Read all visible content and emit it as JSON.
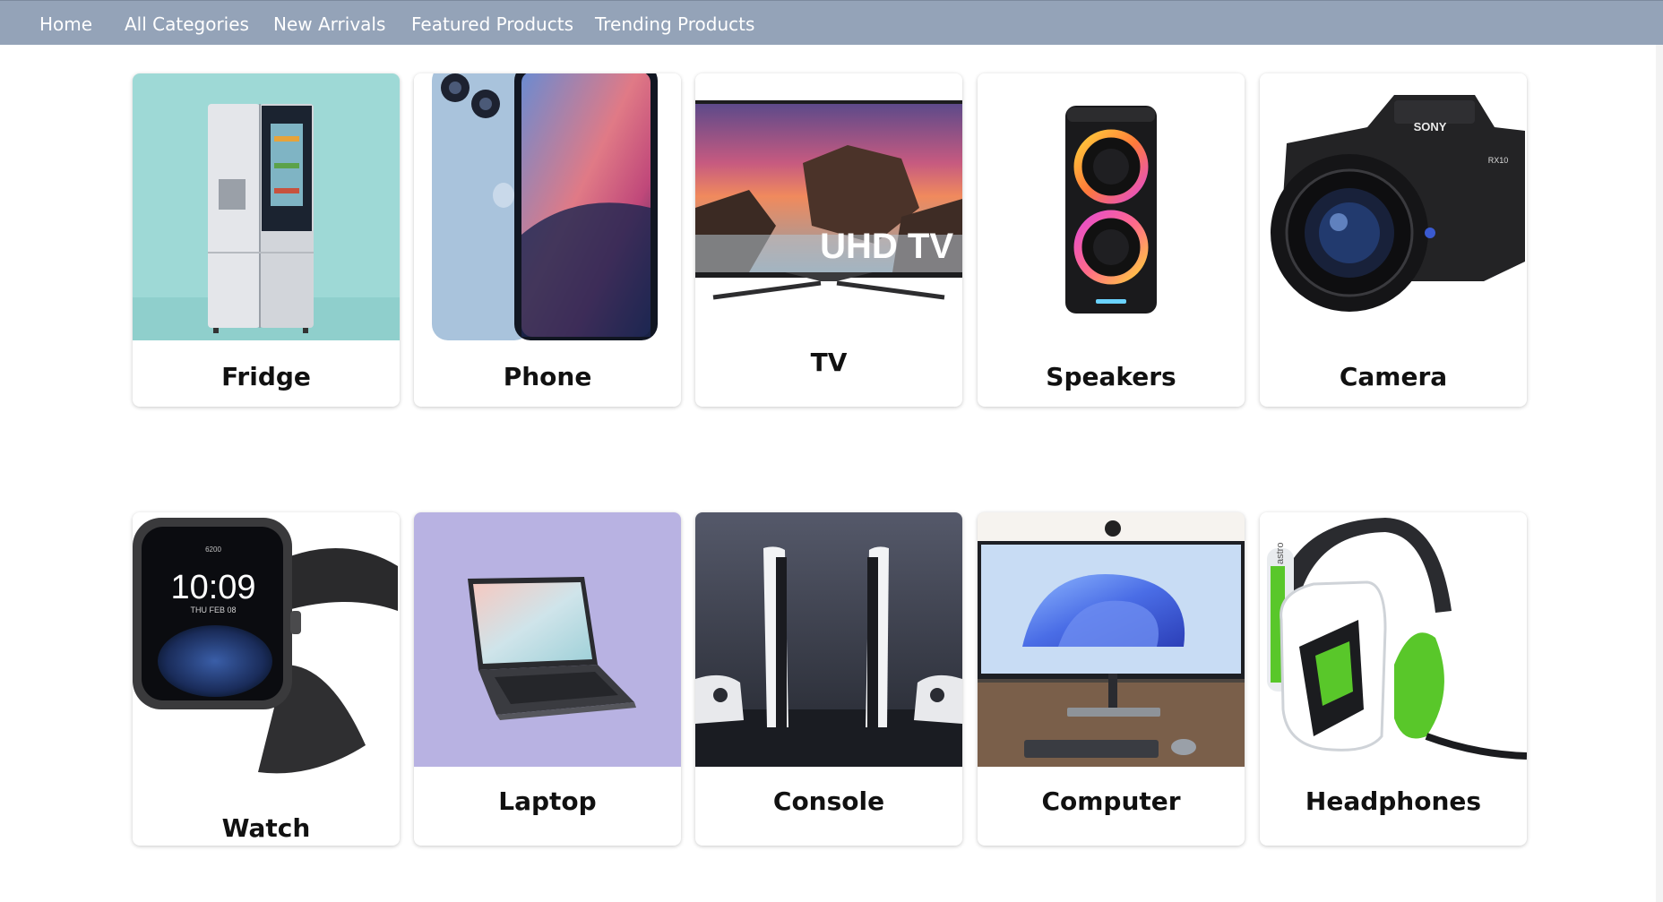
{
  "nav": {
    "home": "Home",
    "all_categories": "All Categories",
    "new_arrivals": "New Arrivals",
    "featured_products": "Featured Products",
    "trending_products": "Trending Products"
  },
  "categories": [
    {
      "label": "Fridge",
      "icon": "fridge-icon"
    },
    {
      "label": "Phone",
      "icon": "phone-icon"
    },
    {
      "label": "TV",
      "icon": "tv-icon",
      "overlay_text": "UHD TV"
    },
    {
      "label": "Speakers",
      "icon": "speaker-icon"
    },
    {
      "label": "Camera",
      "icon": "camera-icon",
      "brand_text": "SONY",
      "model_text": "RX10"
    },
    {
      "label": "Watch",
      "icon": "watch-icon",
      "time_text": "10:09",
      "date_text": "THU FEB 08",
      "steps_text": "6200"
    },
    {
      "label": "Laptop",
      "icon": "laptop-icon"
    },
    {
      "label": "Console",
      "icon": "console-icon"
    },
    {
      "label": "Computer",
      "icon": "computer-icon"
    },
    {
      "label": "Headphones",
      "icon": "headphones-icon",
      "brand_text": "astro"
    }
  ],
  "colors": {
    "navbar": "#94a3b8",
    "fridge_bg": "#9ed9d6",
    "laptop_bg": "#b8b2e2",
    "console_bg": "#3f4450",
    "headphones_accent": "#59c72a"
  }
}
